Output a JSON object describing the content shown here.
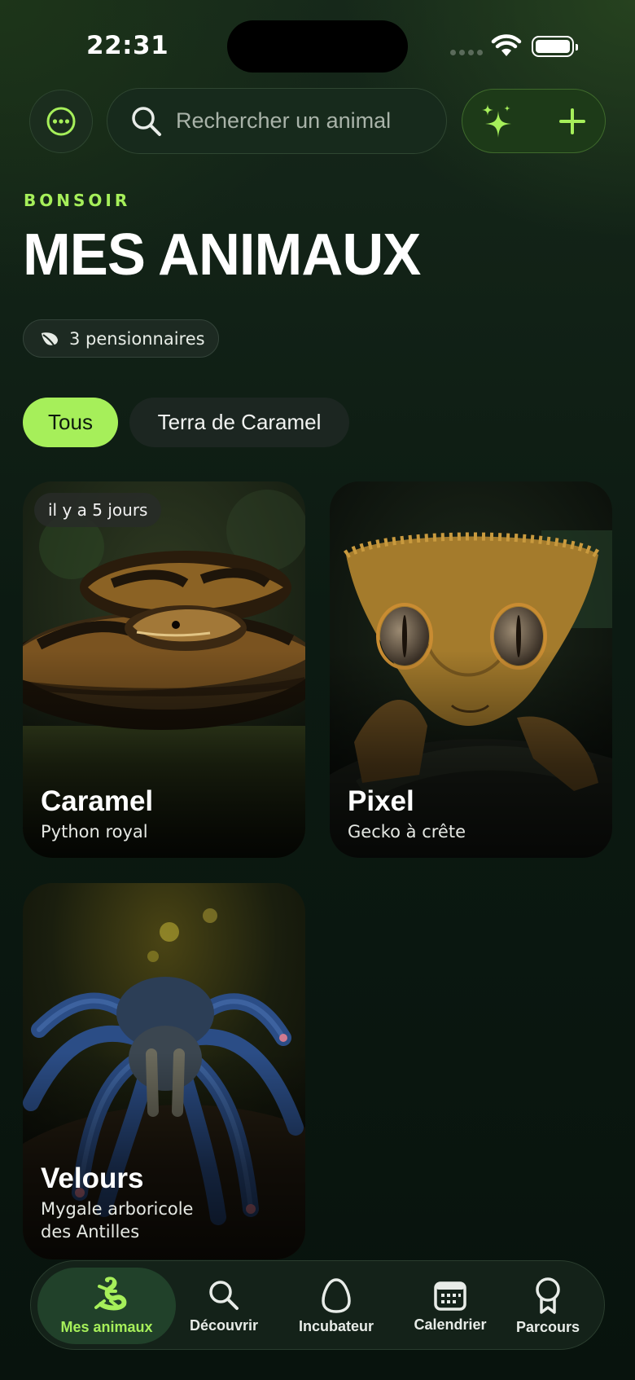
{
  "status_bar": {
    "time": "22:31"
  },
  "header": {
    "search_placeholder": "Rechercher un animal",
    "menu_icon": "ellipsis-icon",
    "ai_icon": "sparkles-icon",
    "add_icon": "plus-icon"
  },
  "greeting": "BONSOIR",
  "title": "MES ANIMAUX",
  "count_label": "3 pensionnaires",
  "filters": [
    "Tous",
    "Terra de Caramel"
  ],
  "animals": [
    {
      "name": "Caramel",
      "species": "Python royal",
      "badge": "il y a 5 jours"
    },
    {
      "name": "Pixel",
      "species": "Gecko à crête"
    },
    {
      "name": "Velours",
      "species_line1": "Mygale arboricole",
      "species_line2": "des Antilles"
    }
  ],
  "nav": [
    "Mes animaux",
    "Découvrir",
    "Incubateur",
    "Calendrier",
    "Parcours"
  ],
  "colors": {
    "accent": "#a6ef5a",
    "background": "#0c1a12"
  }
}
